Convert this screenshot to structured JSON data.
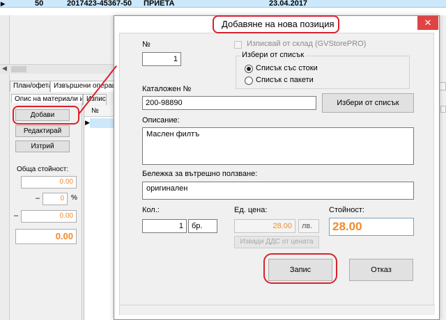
{
  "background": {
    "row": {
      "number": "50",
      "document": "2017423-45367-50",
      "status": "ПРИЕТА",
      "date": "23.04.2017"
    },
    "tabs": [
      "План/офета",
      "Извършени операции"
    ],
    "subtabs": [
      "Опис на материали и части",
      "Изпис"
    ],
    "buttons": {
      "add": "Добави",
      "edit": "Редактирай",
      "delete": "Изтрий"
    },
    "total_label": "Обща стойност:",
    "total_field_1": "0.00",
    "percent_value": "0",
    "percent_sign": "%",
    "minus_sign": "–",
    "total_field_2": "0.00",
    "grand_total": "0.00",
    "grid_header": "№"
  },
  "dialog": {
    "title": "Добавяне на нова позиция",
    "close_symbol": "✕",
    "number_label": "№",
    "number_value": "1",
    "warehouse_checkbox_label": "Изписвай от склад (GVStorePRO)",
    "choose_group_title": "Избери от списък",
    "radio_goods": "Списък със стоки",
    "radio_packages": "Списък с пакети",
    "catalog_label": "Каталожен №",
    "catalog_value": "200-98890",
    "choose_from_list_button": "Избери от списък",
    "description_label": "Описание:",
    "description_value": "Маслен филтъ",
    "internal_note_label": "Бележка за вътрешно ползване:",
    "internal_note_value": "оригинален",
    "qty_label": "Кол.:",
    "qty_value": "1",
    "unit_value": "бр.",
    "unit_price_label": "Ед. цена:",
    "unit_price_value": "28.00",
    "currency_value": "лв.",
    "extract_vat_button": "Извади ДДС от цената",
    "value_label": "Стойност:",
    "value_amount": "28.00",
    "save_button": "Запис",
    "cancel_button": "Отказ"
  },
  "colors": {
    "annotation_red": "#d9202c",
    "amount_orange": "#f08a2c",
    "close_red": "#e04343"
  }
}
